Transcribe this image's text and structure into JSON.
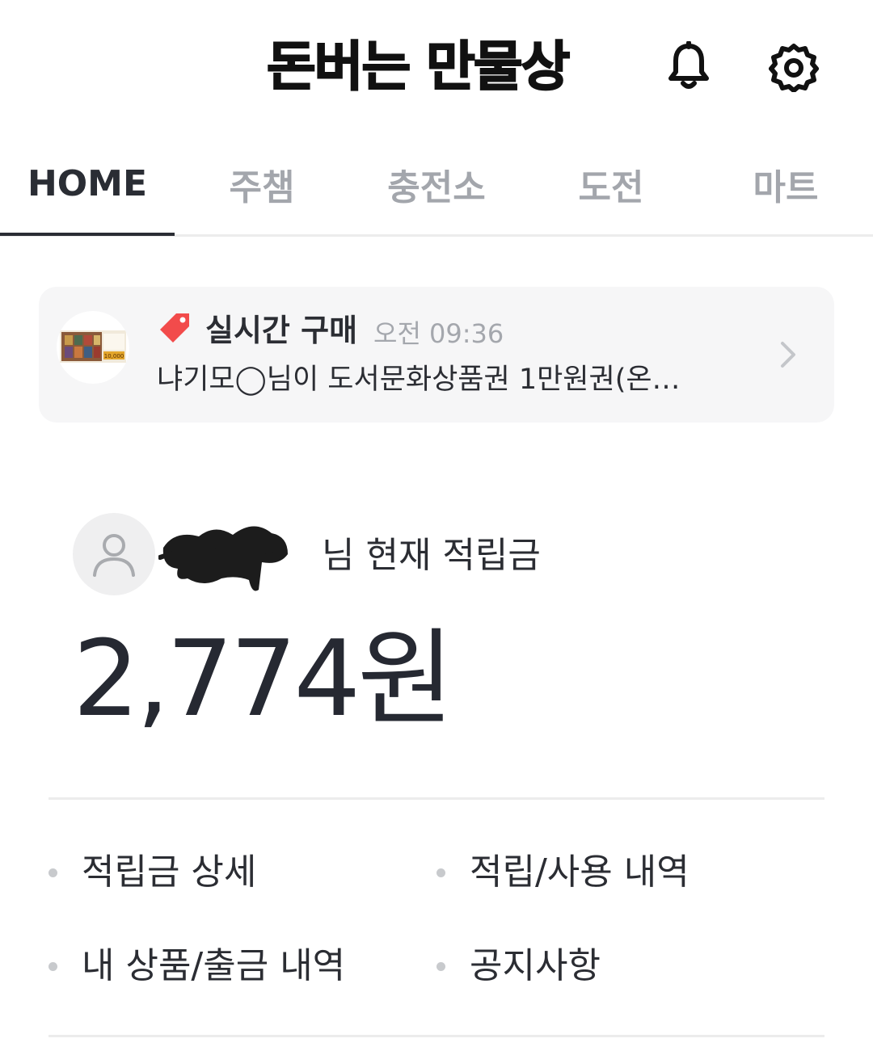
{
  "header": {
    "title": "돈버는 만물상",
    "notifications_icon": "bell-icon",
    "settings_icon": "gear-icon"
  },
  "tabs": [
    {
      "label": "HOME",
      "active": true
    },
    {
      "label": "주챔",
      "active": false
    },
    {
      "label": "충전소",
      "active": false
    },
    {
      "label": "도전",
      "active": false
    },
    {
      "label": "마트",
      "active": false
    }
  ],
  "realtime": {
    "label": "실시간 구매",
    "time": "오전 09:36",
    "message": "냐기모◯님이 도서문화상품권 1만원권(온…",
    "thumbnail_text": "10,000",
    "tag_color": "#f24b4b"
  },
  "points": {
    "label": "님 현재 적립금",
    "value": "2,774원"
  },
  "menu": [
    {
      "label": "적립금 상세"
    },
    {
      "label": "적립/사용 내역"
    },
    {
      "label": "내 상품/출금 내역"
    },
    {
      "label": "공지사항"
    }
  ]
}
